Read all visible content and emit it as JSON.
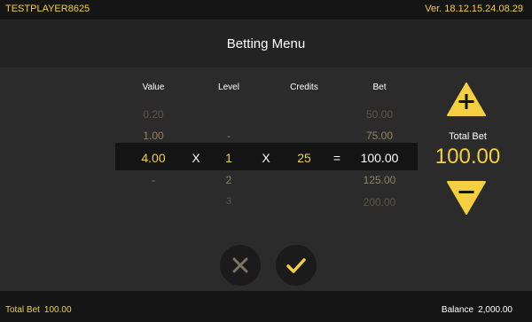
{
  "top_bar": {
    "player_name": "TESTPLAYER8625",
    "version": "Ver. 18.12.15.24.08.29"
  },
  "header": {
    "title": "Betting Menu"
  },
  "columns": {
    "value": "Value",
    "level": "Level",
    "credits": "Credits",
    "bet": "Bet"
  },
  "rows": {
    "above2": {
      "value": "0.20",
      "level": "",
      "bet": "50.00"
    },
    "above1": {
      "value": "1.00",
      "level": "-",
      "bet": "75.00"
    },
    "selected": {
      "value": "4.00",
      "op1": "X",
      "level": "1",
      "op2": "X",
      "credits": "25",
      "op3": "=",
      "bet": "100.00"
    },
    "below1": {
      "value": "-",
      "level": "2",
      "bet": "125.00"
    },
    "below2": {
      "value": "",
      "level": "3",
      "bet": "200.00"
    }
  },
  "side": {
    "total_bet_label": "Total Bet",
    "total_bet_value": "100.00"
  },
  "bottom_bar": {
    "total_bet_label": "Total Bet",
    "total_bet_value": "100.00",
    "balance_label": "Balance",
    "balance_value": "2,000.00"
  },
  "colors": {
    "accent": "#f4cf3f",
    "background": "#2a2a2a",
    "bar": "#151515"
  }
}
